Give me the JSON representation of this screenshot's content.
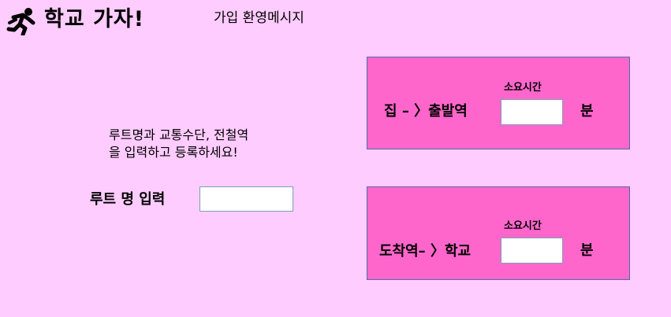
{
  "header": {
    "logo_icon": "running-person-icon",
    "title": "학교 가자!",
    "welcome": "가입 환영메시지"
  },
  "route": {
    "instructions": "루트명과 교통수단, 전철역을 입력하고 등록하세요!",
    "label": "루트 명 입력",
    "input_value": ""
  },
  "panels": [
    {
      "label": "집 – 〉출발역",
      "time_caption": "소요시간",
      "time_value": "",
      "unit": "분"
    },
    {
      "label": "도착역– 〉학교",
      "time_caption": "소요시간",
      "time_value": "",
      "unit": "분"
    }
  ],
  "colors": {
    "background": "#ffccff",
    "panel": "#ff66cc",
    "panel_border": "#4d6ea8"
  }
}
